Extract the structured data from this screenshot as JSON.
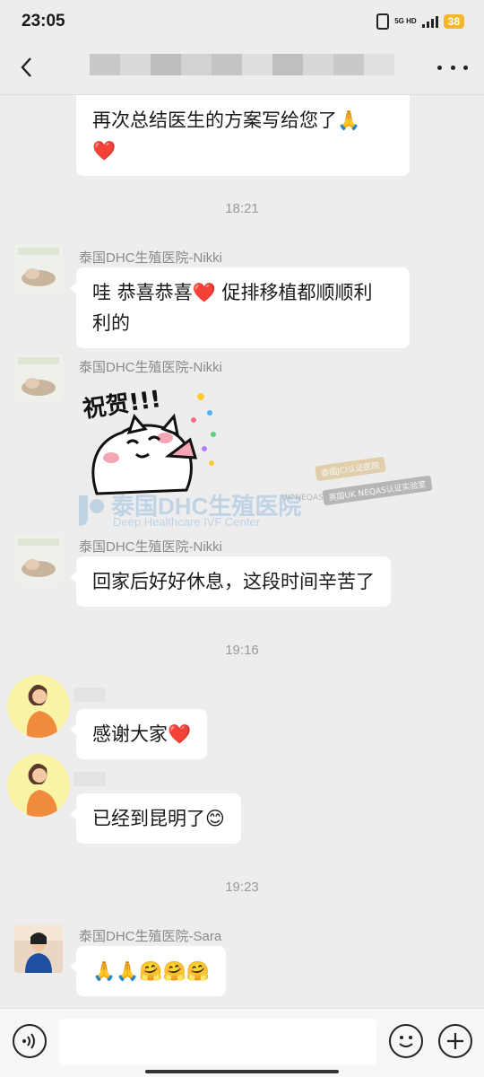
{
  "status_bar": {
    "time": "23:05",
    "network": "5G HD",
    "battery": "38"
  },
  "nav": {
    "back_icon": "back-arrow-icon",
    "more_icon": "more-dots-icon"
  },
  "messages": [
    {
      "text": "再次总结医生的方案写给您了🙏",
      "text2": "❤️"
    },
    {
      "time": "18:21"
    },
    {
      "sender": "泰国DHC生殖医院-Nikki",
      "text": "哇 恭喜恭喜❤️ 促排移植都顺顺利",
      "text2": "利的"
    },
    {
      "sender": "泰国DHC生殖医院-Nikki",
      "sticker_text": "祝贺!!!"
    },
    {
      "sender": "泰国DHC生殖医院-Nikki",
      "text": "回家后好好休息，这段时间辛苦了"
    },
    {
      "time": "19:16"
    },
    {
      "text": "感谢大家❤️"
    },
    {
      "text": "已经到昆明了😊"
    },
    {
      "time": "19:23"
    },
    {
      "sender": "泰国DHC生殖医院-Sara",
      "text": "🙏🙏🤗🤗🤗"
    }
  ],
  "watermark": {
    "title": "泰国DHC生殖医院",
    "subtitle": "Deep Healthcare IVF Center",
    "badge1": "泰国JCI认证医院",
    "badge2": "英国UK NEQAS认证实验室",
    "ukneqas": "UK NEQAS"
  }
}
